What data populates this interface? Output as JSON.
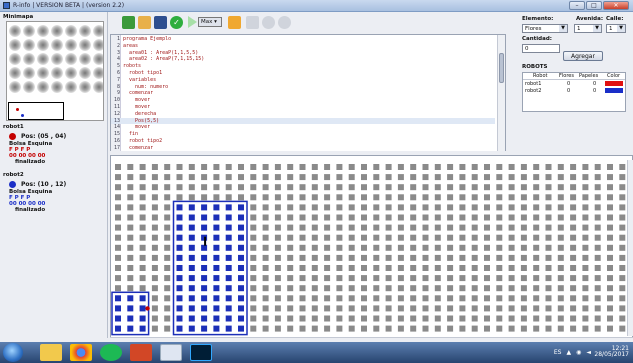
{
  "window": {
    "title": "R-info  |  VERSION BETA  |  (version 2.2)",
    "minimize": "–",
    "maximize": "□",
    "close": "✕"
  },
  "left_panel": {
    "minimap_label": "Minimapa",
    "robots": [
      {
        "name": "robot1",
        "color": "#c40000",
        "pos": "Pos: (05 , 04)",
        "header": "Bolsa  Esquina",
        "letters": "F  P  F   P",
        "counts": "00  00  00  00",
        "status": "finalizado"
      },
      {
        "name": "robot2",
        "color": "#1c2fc7",
        "pos": "Pos: (10 , 12)",
        "header": "Bolsa  Esquina",
        "letters": "F  P  F   P",
        "counts": "00  00  00  00",
        "status": "finalizado"
      }
    ]
  },
  "toolbar": {
    "max_label": "Max ▾",
    "icons": [
      "tree-icon",
      "open-folder-icon",
      "save-icon",
      "check-icon",
      "play-icon",
      "brush-icon",
      "step-icon",
      "stop-icon",
      "pause-icon"
    ]
  },
  "editor": {
    "lines": [
      {
        "n": "1",
        "text": "programa Ejemplo"
      },
      {
        "n": "2",
        "text": "areas"
      },
      {
        "n": "3",
        "text": "  area01 : AreaP(1,1,5,5)"
      },
      {
        "n": "4",
        "text": "  area02 : AreaP(7,1,15,15)"
      },
      {
        "n": "5",
        "text": "robots"
      },
      {
        "n": "6",
        "text": "  robot tipo1"
      },
      {
        "n": "7",
        "text": "  variables"
      },
      {
        "n": "8",
        "text": "    num: numero"
      },
      {
        "n": "9",
        "text": "  comenzar"
      },
      {
        "n": "10",
        "text": "    mover"
      },
      {
        "n": "11",
        "text": "    mover"
      },
      {
        "n": "12",
        "text": "    derecha"
      },
      {
        "n": "13",
        "text": "    Pos(5,5)"
      },
      {
        "n": "14",
        "text": "    mover"
      },
      {
        "n": "15",
        "text": "  fin"
      },
      {
        "n": "16",
        "text": "  robot tipo2"
      },
      {
        "n": "17",
        "text": "  comenzar"
      }
    ],
    "highlight_line": 13
  },
  "right_panel": {
    "elementos_label": "Elemento:",
    "avenida_label": "Avenida:",
    "calle_label": "Calle:",
    "elemento_value": "Flores",
    "avenida_value": "1",
    "calle_value": "1",
    "cantidad_label": "Cantidad:",
    "cantidad_value": "0",
    "agregar_button": "Agregar",
    "robots_label": "ROBOTS",
    "table_headers": [
      "Robot",
      "Flores",
      "Papeles",
      "Color"
    ],
    "table_rows": [
      {
        "robot": "robot1",
        "flores": "0",
        "papeles": "0",
        "color": "#e01010"
      },
      {
        "robot": "robot2",
        "flores": "0",
        "papeles": "0",
        "color": "#1a2ec8"
      }
    ]
  },
  "map": {
    "grid_color": "#8a8a8a",
    "area_color": "#1c2fb8",
    "robot1_color": "#c40000",
    "robot2_color": "#1c2fc7"
  },
  "taskbar": {
    "apps": [
      "explorer-icon",
      "chrome-icon",
      "spotify-icon",
      "powerpoint-icon",
      "rinfo-icon",
      "photoshop-icon"
    ],
    "lang": "ES",
    "time": "12:21",
    "date": "28/05/2017"
  }
}
